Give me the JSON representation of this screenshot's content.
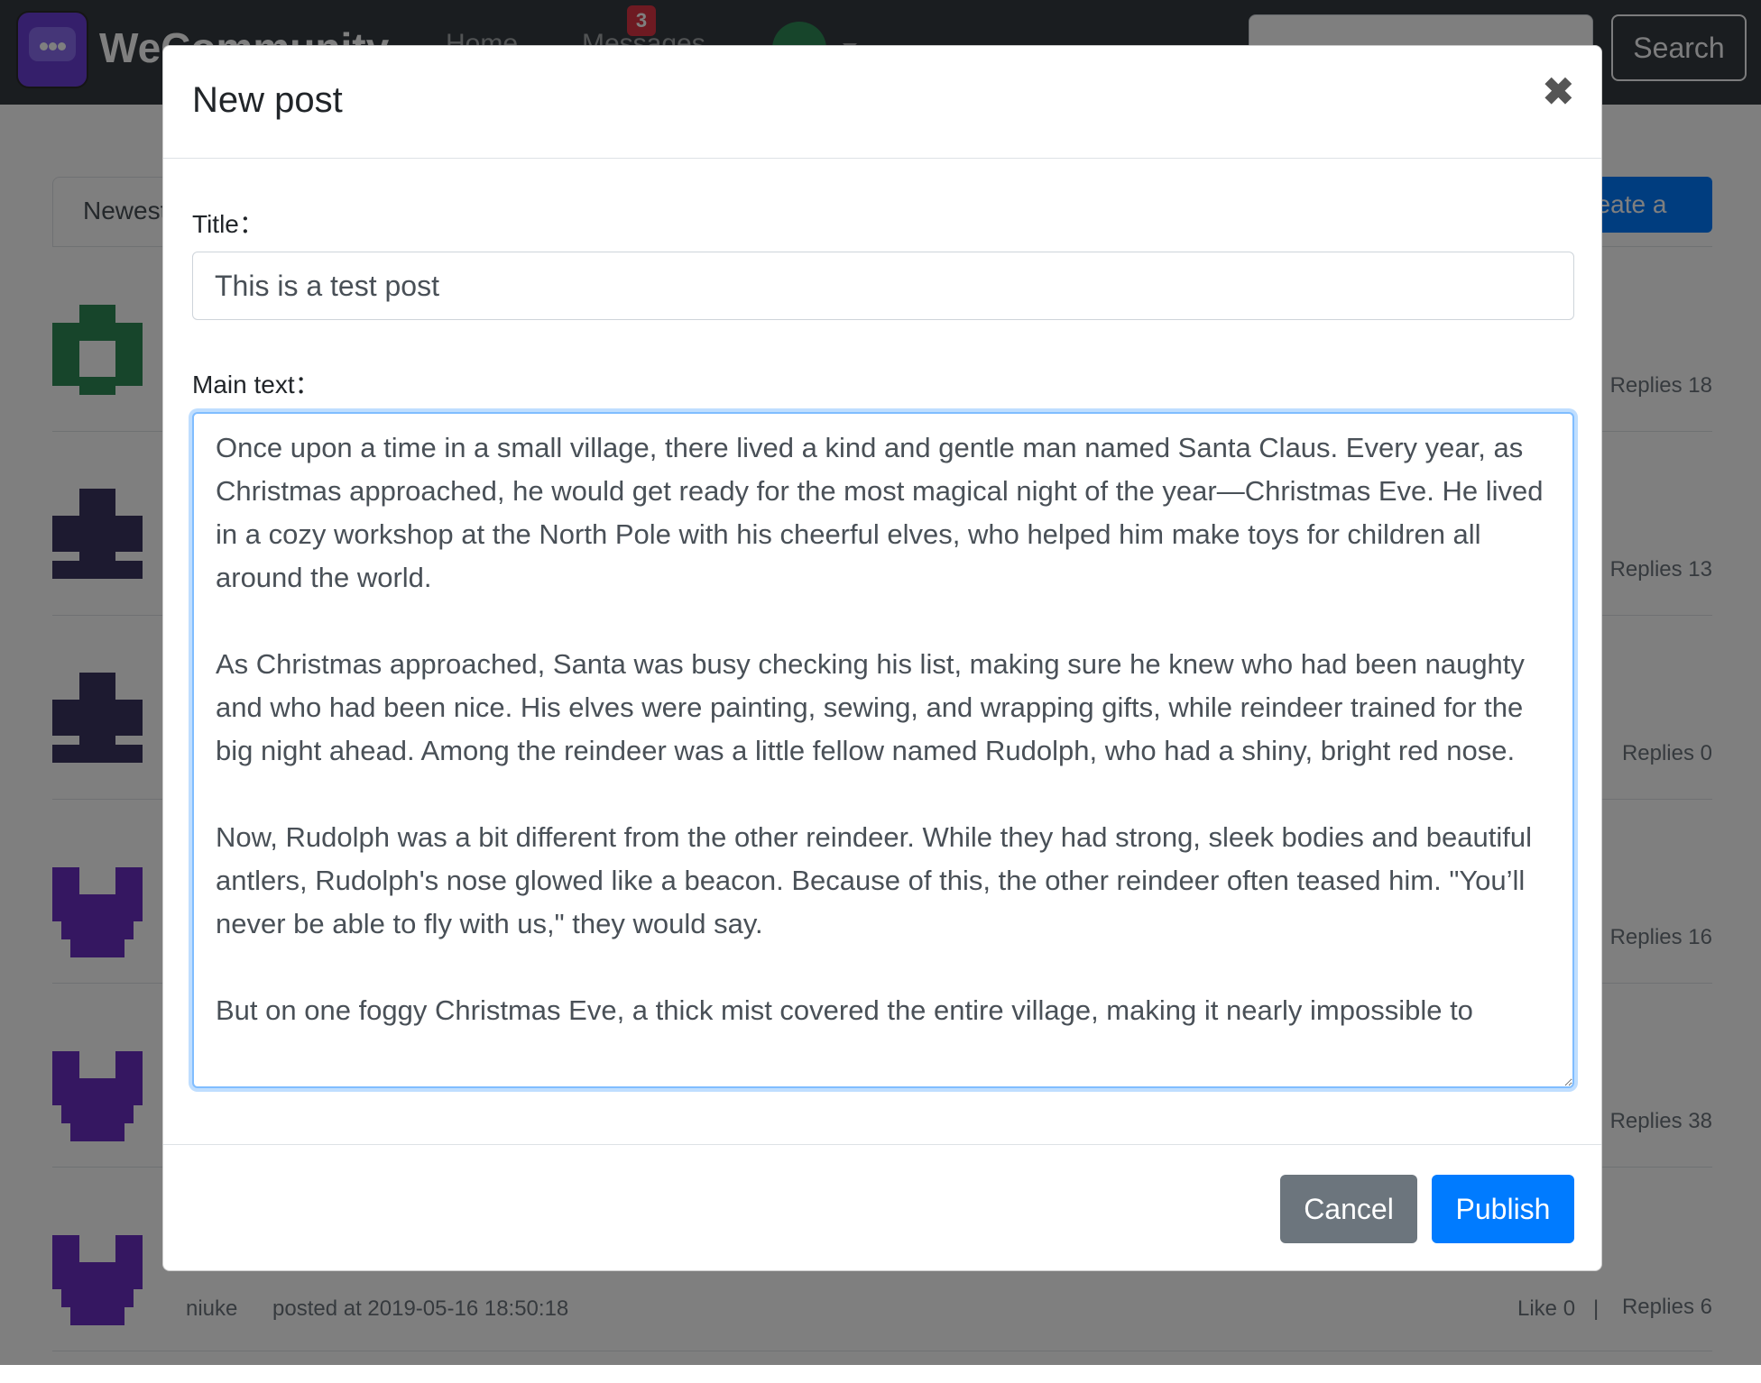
{
  "navbar": {
    "brand": "WeCommunity",
    "nav_home": "Home",
    "nav_messages": "Messages",
    "messages_badge": "3",
    "search_button": "Search"
  },
  "page": {
    "tab_newest": "Newest",
    "create_post": "Create a post",
    "posts": [
      {
        "replies": "Replies 18",
        "avatar_color": "#2e8b57"
      },
      {
        "replies": "Replies 13",
        "avatar_color": "#3b3561"
      },
      {
        "replies": "Replies 0",
        "avatar_color": "#3b3561"
      },
      {
        "replies": "Replies 16",
        "avatar_color": "#6a2fc2"
      },
      {
        "replies": "Replies 38",
        "avatar_color": "#6a2fc2"
      },
      {
        "replies": "Replies 6",
        "avatar_color": "#6a2fc2"
      }
    ],
    "last_author": "niuke",
    "last_posted": "posted at 2019-05-16 18:50:18",
    "last_like": "Like 0",
    "separator": "|"
  },
  "modal": {
    "title": "New post",
    "close_glyph": "✖",
    "title_label": "Title：",
    "title_value": "This is a test post",
    "body_label": "Main text：",
    "body_value": "Once upon a time in a small village, there lived a kind and gentle man named Santa Claus. Every year, as Christmas approached, he would get ready for the most magical night of the year—Christmas Eve. He lived in a cozy workshop at the North Pole with his cheerful elves, who helped him make toys for children all around the world.\n\nAs Christmas approached, Santa was busy checking his list, making sure he knew who had been naughty and who had been nice. His elves were painting, sewing, and wrapping gifts, while reindeer trained for the big night ahead. Among the reindeer was a little fellow named Rudolph, who had a shiny, bright red nose.\n\nNow, Rudolph was a bit different from the other reindeer. While they had strong, sleek bodies and beautiful antlers, Rudolph's nose glowed like a beacon. Because of this, the other reindeer often teased him. \"You’ll never be able to fly with us,\" they would say.\n\nBut on one foggy Christmas Eve, a thick mist covered the entire village, making it nearly impossible to",
    "cancel": "Cancel",
    "publish": "Publish"
  }
}
